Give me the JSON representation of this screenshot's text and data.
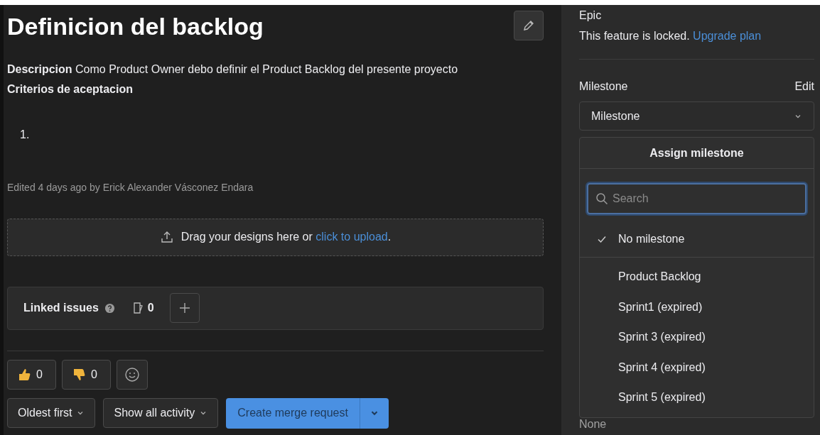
{
  "title": "Definicion del backlog",
  "description": {
    "text": "**Descripcion** Como Product Owner debo definir el Product Backlog del presente proyecto",
    "criteria": "Criterios de aceptacion",
    "list_marker": "1."
  },
  "edited": "Edited 4 days ago by Erick Alexander Vásconez Endara",
  "upload": {
    "text": "Drag your designs here or",
    "link": "click to upload",
    "after": "."
  },
  "linked_issues": {
    "label": "Linked issues",
    "count": "0"
  },
  "reactions": [
    {
      "kind": "thumbsup",
      "count": "0"
    },
    {
      "kind": "thumbsdown",
      "count": "0"
    }
  ],
  "activity": {
    "sort": "Oldest first",
    "filter": "Show all activity",
    "merge_button": "Create merge request"
  },
  "sidebar": {
    "epic": {
      "label": "Epic",
      "text": "This feature is locked.",
      "link": "Upgrade plan"
    },
    "milestone": {
      "label": "Milestone",
      "edit": "Edit",
      "dropdown": "Milestone",
      "menu_title": "Assign milestone",
      "search_placeholder": "Search",
      "value": "None",
      "items": [
        {
          "label": "No milestone",
          "kind": "none",
          "selected": true
        },
        {
          "label": "Product Backlog",
          "kind": "milestone",
          "selected": false
        },
        {
          "label": "Sprint1 (expired)",
          "kind": "milestone",
          "selected": false
        },
        {
          "label": "Sprint 3 (expired)",
          "kind": "milestone",
          "selected": false
        },
        {
          "label": "Sprint 4 (expired)",
          "kind": "milestone",
          "selected": false
        },
        {
          "label": "Sprint 5 (expired)",
          "kind": "milestone",
          "selected": false
        }
      ]
    }
  }
}
